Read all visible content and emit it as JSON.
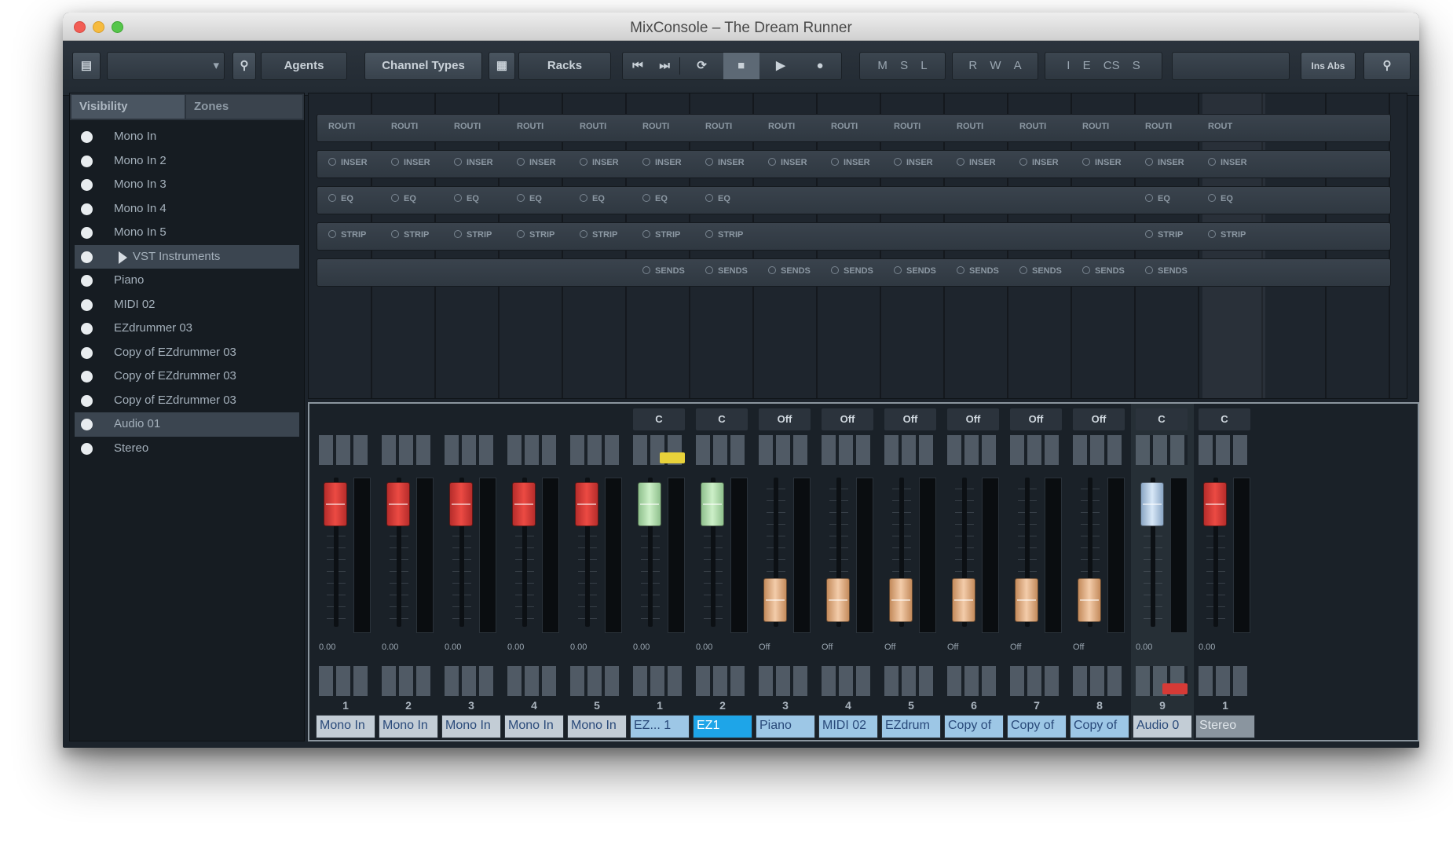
{
  "window": {
    "title": "MixConsole – The Dream Runner"
  },
  "toolbar": {
    "agents": "Agents",
    "channel_types": "Channel Types",
    "racks": "Racks",
    "m_s_l": [
      "M",
      "S",
      "L"
    ],
    "r_w_a": [
      "R",
      "W",
      "A"
    ],
    "i_e_cs_s": [
      "I",
      "E",
      "CS",
      "S"
    ],
    "misc": "Ins Abs"
  },
  "left_panel": {
    "tabs": [
      "Visibility",
      "Zones"
    ],
    "items": [
      {
        "label": "Mono In",
        "selected": false,
        "group": false
      },
      {
        "label": "Mono In 2",
        "selected": false,
        "group": false
      },
      {
        "label": "Mono In 3",
        "selected": false,
        "group": false
      },
      {
        "label": "Mono In 4",
        "selected": false,
        "group": false
      },
      {
        "label": "Mono In 5",
        "selected": false,
        "group": false
      },
      {
        "label": "VST Instruments",
        "selected": true,
        "group": true
      },
      {
        "label": "Piano",
        "selected": false,
        "group": false
      },
      {
        "label": "MIDI 02",
        "selected": false,
        "group": false
      },
      {
        "label": "EZdrummer 03",
        "selected": false,
        "group": false
      },
      {
        "label": "Copy of EZdrummer 03",
        "selected": false,
        "group": false
      },
      {
        "label": "Copy of EZdrummer 03",
        "selected": false,
        "group": false
      },
      {
        "label": "Copy of EZdrummer 03",
        "selected": false,
        "group": false
      },
      {
        "label": "Audio 01",
        "selected": true,
        "group": false
      },
      {
        "label": "Stereo",
        "selected": false,
        "group": false
      }
    ]
  },
  "racks": {
    "routing_label": "ROUTI",
    "routing_label_last": "ROUT",
    "insert_label": "INSER",
    "eq_label": "EQ",
    "strip_label": "STRIP",
    "sends_label": "SENDS"
  },
  "strips": [
    {
      "num": "1",
      "name": "Mono In",
      "fader": "red",
      "fader_pos": 0.18,
      "vol": "0.00",
      "kind": "audio"
    },
    {
      "num": "2",
      "name": "Mono In",
      "fader": "red",
      "fader_pos": 0.18,
      "vol": "0.00",
      "kind": "audio"
    },
    {
      "num": "3",
      "name": "Mono In",
      "fader": "red",
      "fader_pos": 0.18,
      "vol": "0.00",
      "kind": "audio"
    },
    {
      "num": "4",
      "name": "Mono In",
      "fader": "red",
      "fader_pos": 0.18,
      "vol": "0.00",
      "kind": "audio"
    },
    {
      "num": "5",
      "name": "Mono In",
      "fader": "red",
      "fader_pos": 0.18,
      "vol": "0.00",
      "kind": "audio"
    },
    {
      "num": "1",
      "name": "EZ... 1",
      "fader": "green",
      "fader_pos": 0.18,
      "vol": "0.00",
      "kind": "inst",
      "io": "C"
    },
    {
      "num": "2",
      "name": "EZ1",
      "fader": "green",
      "fader_pos": 0.18,
      "vol": "0.00",
      "kind": "inst-sel",
      "io": "C"
    },
    {
      "num": "3",
      "name": "Piano",
      "fader": "tan",
      "fader_pos": 0.82,
      "vol": "Off",
      "kind": "inst",
      "io": "Off"
    },
    {
      "num": "4",
      "name": "MIDI 02",
      "fader": "tan",
      "fader_pos": 0.82,
      "vol": "Off",
      "kind": "inst",
      "io": "Off"
    },
    {
      "num": "5",
      "name": "EZdrum",
      "fader": "tan",
      "fader_pos": 0.82,
      "vol": "Off",
      "kind": "inst",
      "io": "Off"
    },
    {
      "num": "6",
      "name": "Copy of",
      "fader": "tan",
      "fader_pos": 0.82,
      "vol": "Off",
      "kind": "inst",
      "io": "Off"
    },
    {
      "num": "7",
      "name": "Copy of",
      "fader": "tan",
      "fader_pos": 0.82,
      "vol": "Off",
      "kind": "inst",
      "io": "Off"
    },
    {
      "num": "8",
      "name": "Copy of",
      "fader": "tan",
      "fader_pos": 0.82,
      "vol": "Off",
      "kind": "inst",
      "io": "Off"
    },
    {
      "num": "9",
      "name": "Audio 0",
      "fader": "blue",
      "fader_pos": 0.18,
      "vol": "0.00",
      "kind": "audio",
      "io": "C"
    },
    {
      "num": "1",
      "name": "Stereo",
      "fader": "red",
      "fader_pos": 0.18,
      "vol": "0.00",
      "kind": "stereo",
      "io": "C"
    }
  ],
  "colors": {
    "fader_red": "#e0403a",
    "fader_green": "#c4ecbf",
    "fader_tan": "#efc49e",
    "fader_blue": "#d0e2f5",
    "selected_channel": "#1ea5e8"
  }
}
